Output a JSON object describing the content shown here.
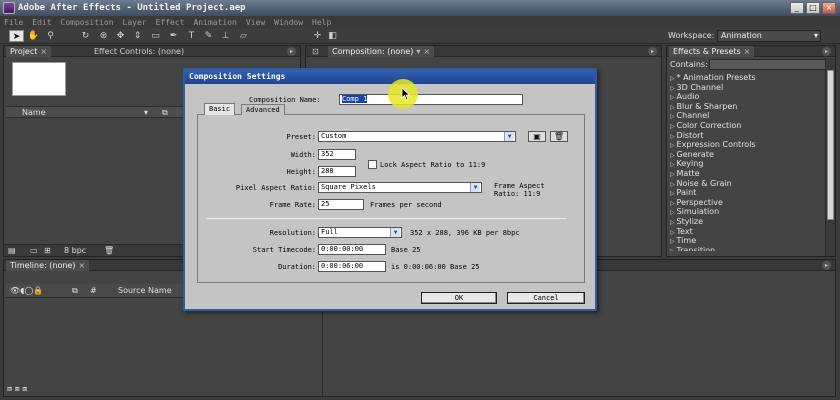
{
  "app": {
    "title": "Adobe After Effects - Untitled Project.aep"
  },
  "window_controls": {
    "minimize": "_",
    "maximize": "□",
    "close": "×"
  },
  "menu": [
    "File",
    "Edit",
    "Composition",
    "Layer",
    "Effect",
    "Animation",
    "View",
    "Window",
    "Help"
  ],
  "toolbar": {
    "tools": [
      "selection-tool-icon",
      "hand-tool-icon",
      "zoom-tool-icon",
      "rotate-tool-icon",
      "orbit-camera-icon",
      "track-xy-icon",
      "track-z-icon",
      "rectangle-mask-icon",
      "pen-tool-icon",
      "text-tool-icon",
      "brush-tool-icon",
      "clone-stamp-icon",
      "eraser-tool-icon"
    ],
    "workspace_label": "Workspace:",
    "workspace_value": "Animation"
  },
  "project_panel": {
    "tabs": [
      "Project",
      "Effect Controls: (none)"
    ],
    "column_name": "Name",
    "footer_bpc": "8 bpc"
  },
  "composition_panel": {
    "tab": "Composition: (none)"
  },
  "effects_panel": {
    "tab": "Effects & Presets",
    "search_label": "Contains:",
    "items": [
      "* Animation Presets",
      "3D Channel",
      "Audio",
      "Blur & Sharpen",
      "Channel",
      "Color Correction",
      "Distort",
      "Expression Controls",
      "Generate",
      "Keying",
      "Matte",
      "Noise & Grain",
      "Paint",
      "Perspective",
      "Simulation",
      "Stylize",
      "Text",
      "Time",
      "Transition"
    ]
  },
  "timeline_panel": {
    "tab": "Timeline: (none)",
    "column_source_name": "Source Name"
  },
  "dialog": {
    "title": "Composition Settings",
    "comp_name_label": "Composition Name:",
    "comp_name_value": "Comp 1",
    "tabs": [
      "Basic",
      "Advanced"
    ],
    "preset_label": "Preset:",
    "preset_value": "Custom",
    "width_label": "Width:",
    "width_value": "352",
    "height_label": "Height:",
    "height_value": "288",
    "lock_aspect_label": "Lock Aspect Ratio to 11:9",
    "lock_aspect_checked": false,
    "pixel_aspect_label": "Pixel Aspect Ratio:",
    "pixel_aspect_value": "Square Pixels",
    "frame_aspect_line1": "Frame Aspect",
    "frame_aspect_line2": "Ratio: 11:9",
    "frame_rate_label": "Frame Rate:",
    "frame_rate_value": "25",
    "frame_rate_unit": "Frames per second",
    "resolution_label": "Resolution:",
    "resolution_value": "Full",
    "resolution_info": "352 x 288, 396 KB per 8bpc",
    "start_timecode_label": "Start Timecode:",
    "start_timecode_value": "0:00:00:00",
    "start_timecode_base": "Base 25",
    "duration_label": "Duration:",
    "duration_value": "0:00:06:00",
    "duration_info": "is 0:00:06:00  Base 25",
    "ok_label": "OK",
    "cancel_label": "Cancel"
  }
}
